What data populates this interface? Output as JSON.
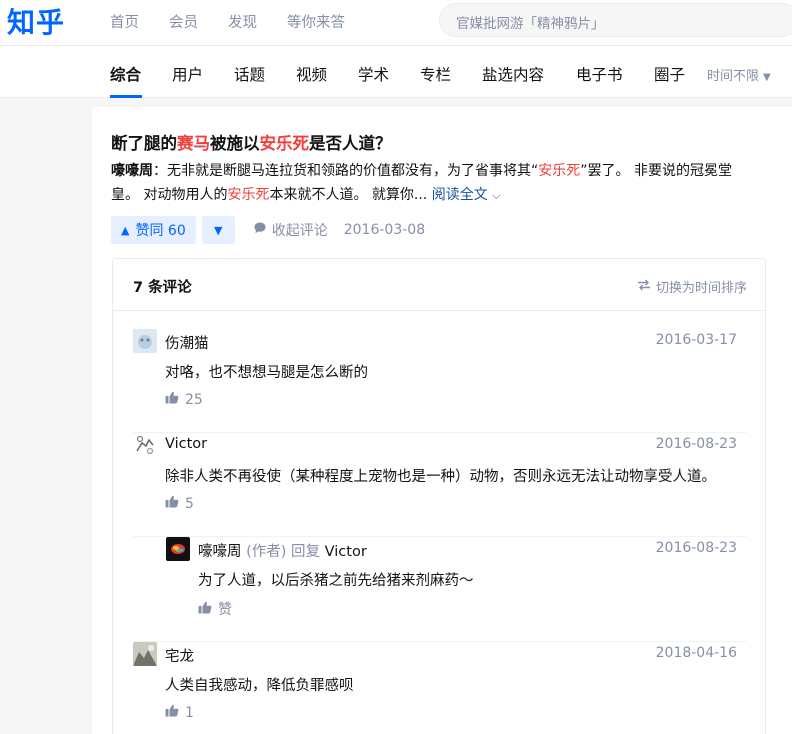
{
  "header": {
    "logo": "知乎",
    "nav": [
      "首页",
      "会员",
      "发现",
      "等你来答"
    ],
    "search_placeholder": "官媒批网游「精神鸦片」"
  },
  "tabs": {
    "items": [
      "综合",
      "用户",
      "话题",
      "视频",
      "学术",
      "专栏",
      "盐选内容",
      "电子书",
      "圈子"
    ],
    "active": "综合",
    "time_filter": "时间不限"
  },
  "question": {
    "title_parts": [
      "断了腿的",
      "赛马",
      "被施以",
      "安乐死",
      "是否人道？"
    ],
    "excerpt": {
      "author": "嚎嚎周",
      "colon": "：",
      "seg1": "无非就是断腿马连拉货和领路的价值都没有，为了省事将其“",
      "hl1": "安乐死",
      "seg2": "”罢了。 非要说的冠冕堂皇。 对动物用人的",
      "hl2": "安乐死",
      "seg3": "本来就不人道。 就算你... ",
      "read_more": "阅读全文"
    },
    "vote_label": "赞同 60",
    "collapse_comments": "收起评论",
    "date": "2016-03-08"
  },
  "comments": {
    "count_label": "7 条评论",
    "sort_label": "切换为时间排序",
    "items": [
      {
        "user": "伤潮猫",
        "date": "2016-03-17",
        "text": "对咯，也不想想马腿是怎么断的",
        "likes": "25"
      },
      {
        "user": "Victor",
        "date": "2016-08-23",
        "text": "除非人类不再役使（某种程度上宠物也是一种）动物，否则永远无法让动物享受人道。",
        "likes": "5"
      },
      {
        "user": "嚎嚎周",
        "author_tag": "(作者)",
        "reply_word": "回复",
        "reply_to": "Victor",
        "date": "2016-08-23",
        "text": "为了人道，以后杀猪之前先给猪来剂麻药～",
        "likes": "赞"
      },
      {
        "user": "宅龙",
        "date": "2018-04-16",
        "text": "人类自我感动，降低负罪感呗",
        "likes": "1"
      }
    ]
  },
  "colors": {
    "brand": "#0066ff",
    "highlight": "#f1403c",
    "muted": "#8590a6",
    "link": "#175199"
  }
}
